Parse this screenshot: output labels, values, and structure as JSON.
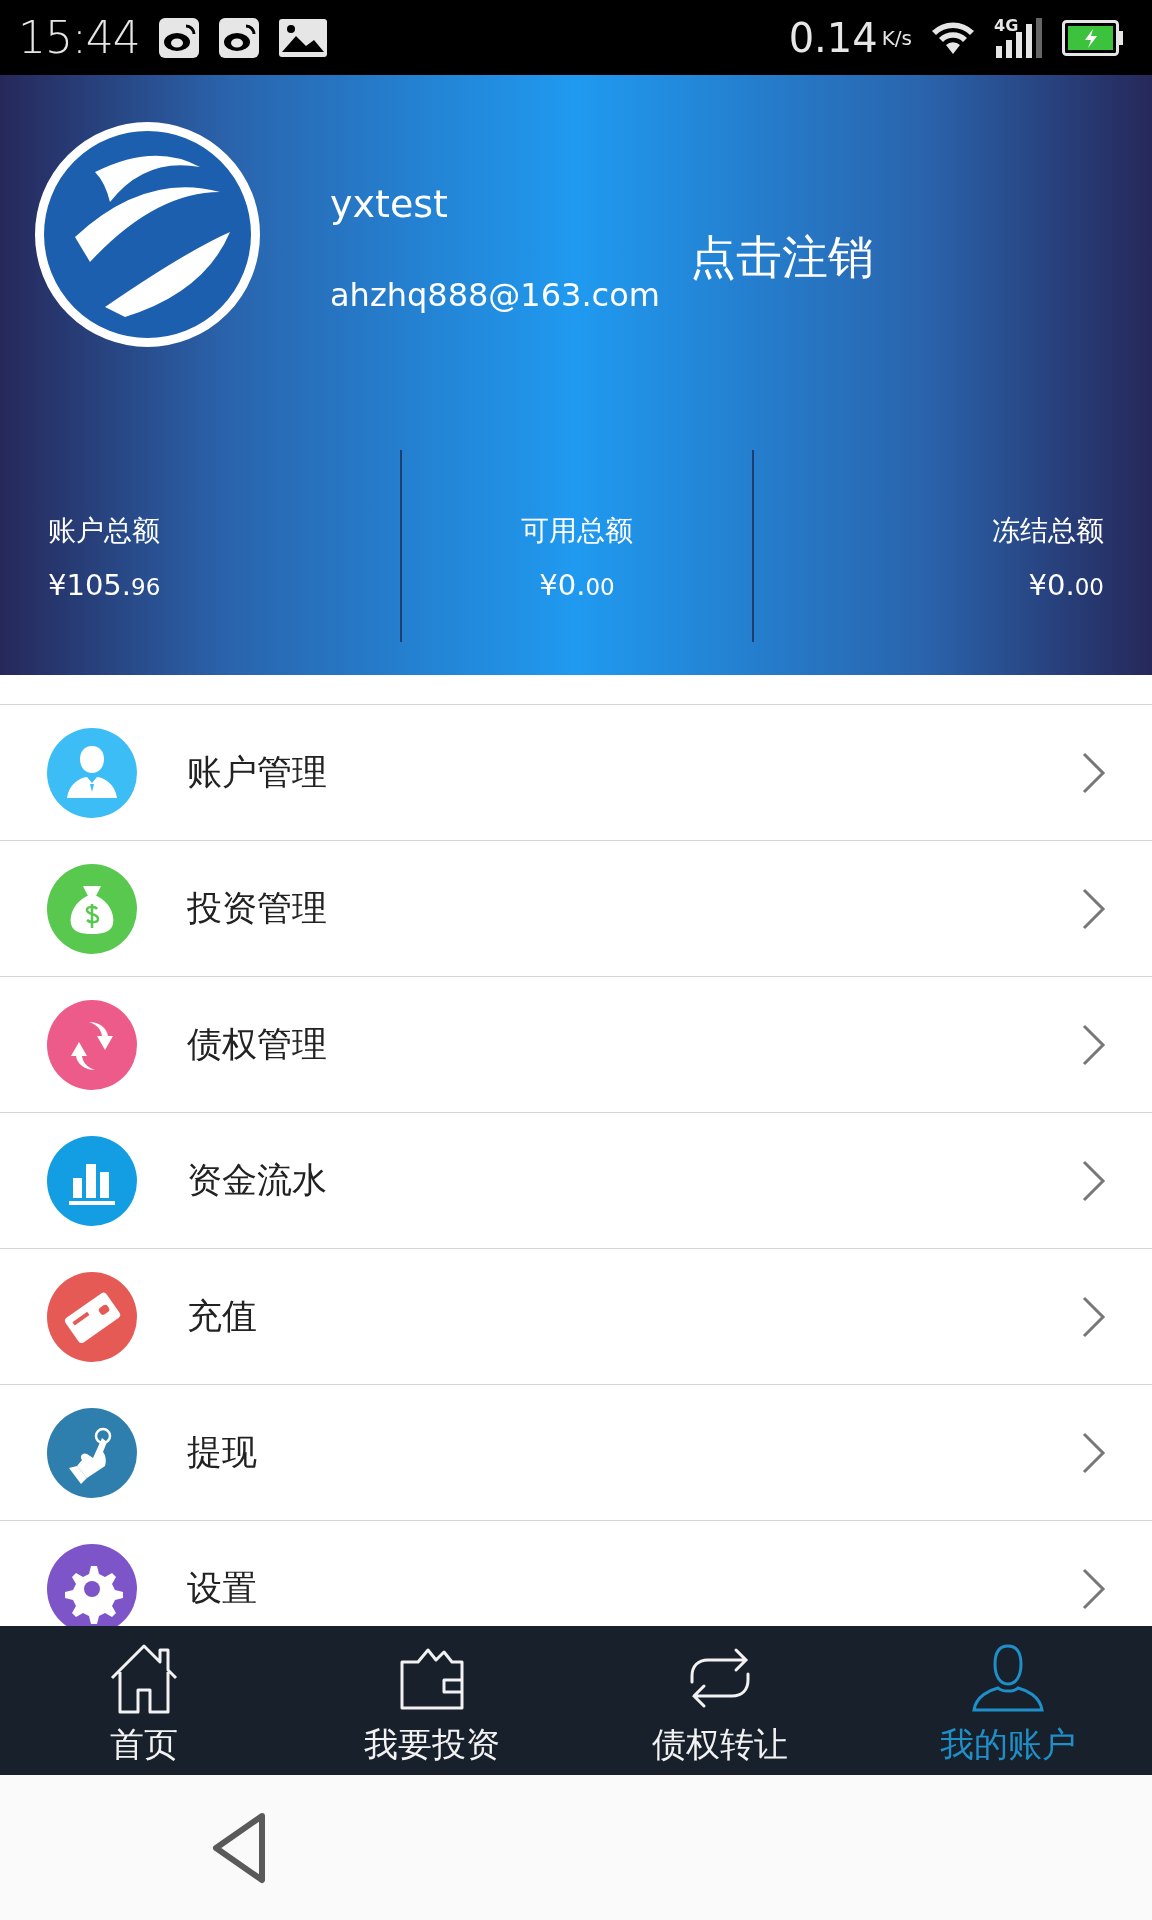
{
  "status_bar": {
    "time": "15:44",
    "speed": "0.14",
    "speed_unit": "K/s",
    "network": "4G"
  },
  "profile": {
    "username": "yxtest",
    "email": "ahzhq888@163.com",
    "logout": "点击注销"
  },
  "balances": [
    {
      "label": "账户总额",
      "amount": "¥105.",
      "cents": "96"
    },
    {
      "label": "可用总额",
      "amount": "¥0.",
      "cents": "00"
    },
    {
      "label": "冻结总额",
      "amount": "¥0.",
      "cents": "00"
    }
  ],
  "menu": [
    {
      "label": "账户管理"
    },
    {
      "label": "投资管理"
    },
    {
      "label": "债权管理"
    },
    {
      "label": "资金流水"
    },
    {
      "label": "充值"
    },
    {
      "label": "提现"
    },
    {
      "label": "设置"
    }
  ],
  "tabs": [
    {
      "label": "首页",
      "selected": false
    },
    {
      "label": "我要投资",
      "selected": false
    },
    {
      "label": "债权转让",
      "selected": false
    },
    {
      "label": "我的账户",
      "selected": true
    }
  ]
}
